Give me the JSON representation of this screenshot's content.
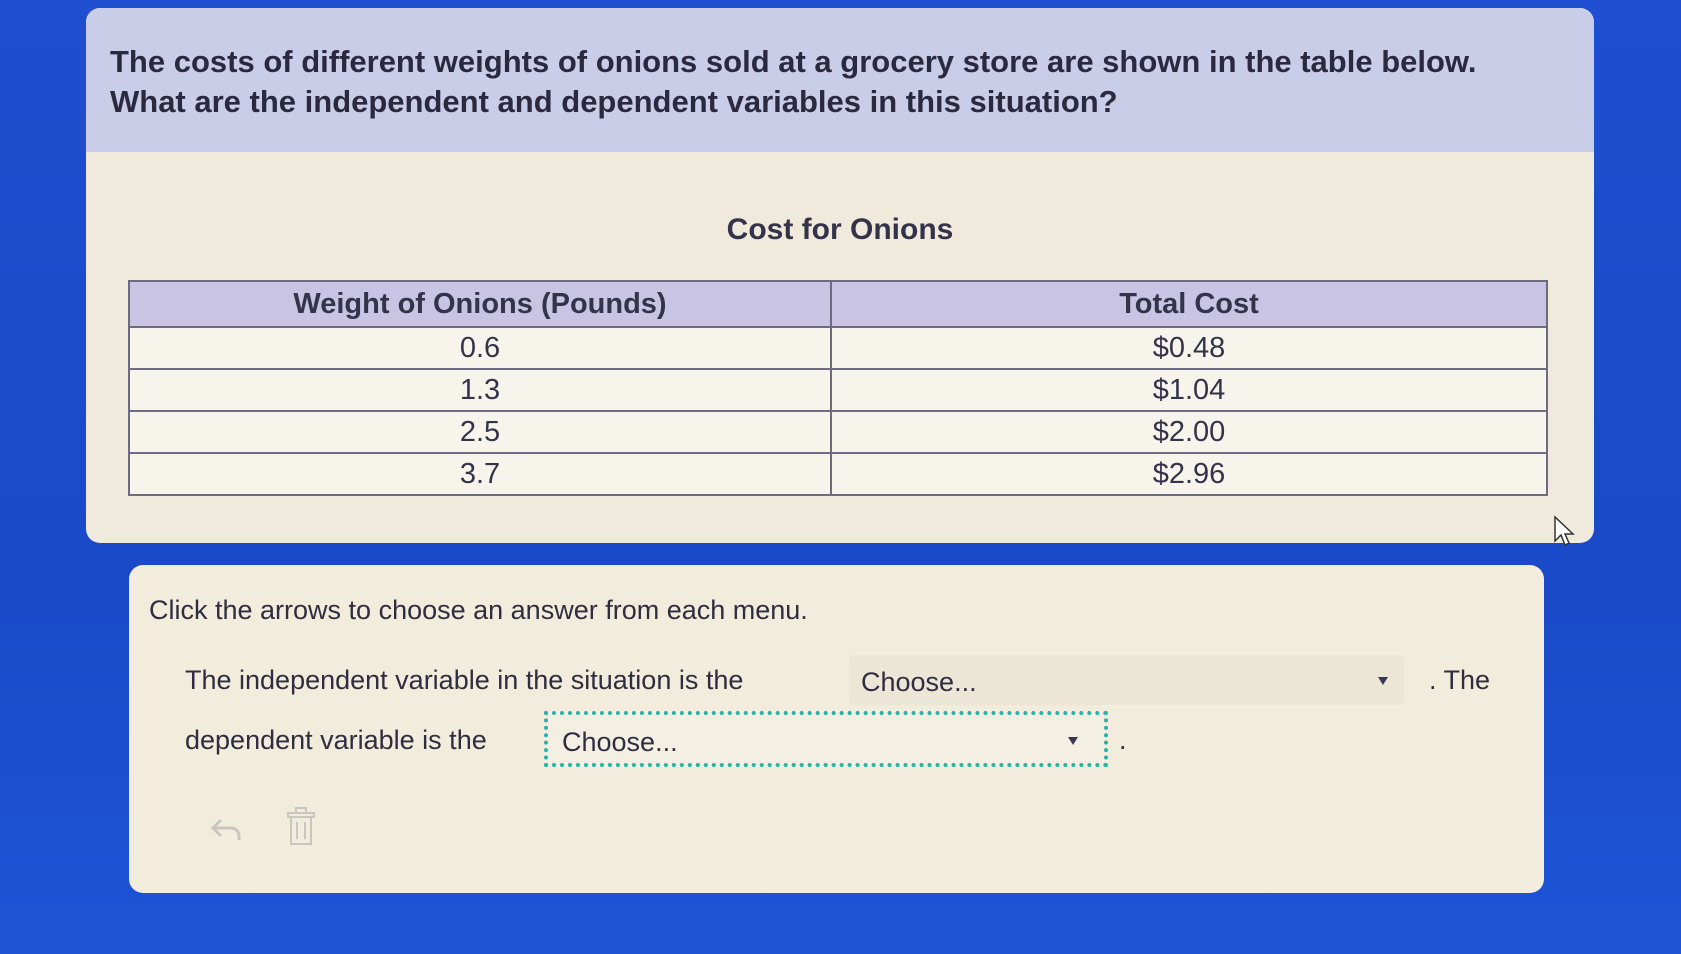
{
  "question": {
    "text": "The costs of different weights of onions sold at a grocery store are shown in the table below. What are the independent and dependent variables in this situation?"
  },
  "table": {
    "title": "Cost for Onions",
    "headers": [
      "Weight of Onions (Pounds)",
      "Total Cost"
    ],
    "rows": [
      [
        "0.6",
        "$0.48"
      ],
      [
        "1.3",
        "$1.04"
      ],
      [
        "2.5",
        "$2.00"
      ],
      [
        "3.7",
        "$2.96"
      ]
    ]
  },
  "answer": {
    "instruction": "Click the arrows to choose an answer from each menu.",
    "line1_prefix": "The independent variable in the situation is the",
    "dropdown1_value": "Choose...",
    "line1_suffix": ". The",
    "line2_prefix": "dependent variable is the",
    "dropdown2_value": "Choose...",
    "line2_suffix": "."
  },
  "icons": {
    "undo": "undo-icon",
    "trash": "trash-icon",
    "cursor": "cursor-icon"
  },
  "colors": {
    "background": "#1f4fd0",
    "header_band": "#c9cde8",
    "table_header": "#c9c4e4",
    "focus_border": "#27b4a4"
  }
}
